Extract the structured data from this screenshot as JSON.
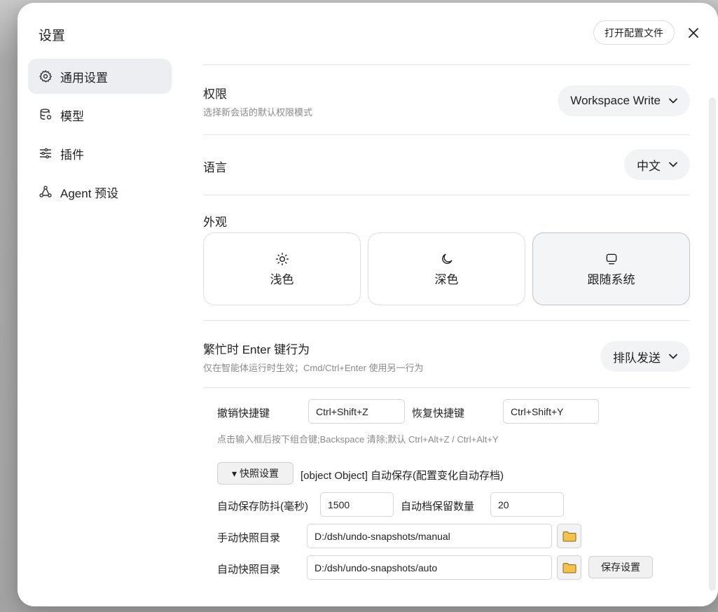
{
  "modal": {
    "title": "设置",
    "open_config_label": "打开配置文件"
  },
  "sidebar": {
    "items": [
      {
        "label": "通用设置",
        "icon": "gear-icon",
        "active": true
      },
      {
        "label": "模型",
        "icon": "database-icon",
        "active": false
      },
      {
        "label": "插件",
        "icon": "sliders-icon",
        "active": false
      },
      {
        "label": "Agent 预设",
        "icon": "network-icon",
        "active": false
      }
    ]
  },
  "permissions": {
    "title": "权限",
    "subtitle": "选择新会话的默认权限模式",
    "value": "Workspace Write"
  },
  "language": {
    "title": "语言",
    "value": "中文"
  },
  "appearance": {
    "title": "外观",
    "options": [
      {
        "label": "浅色",
        "icon": "sun-icon"
      },
      {
        "label": "深色",
        "icon": "moon-icon"
      },
      {
        "label": "跟随系统",
        "icon": "monitor-icon"
      }
    ],
    "selected": "跟随系统"
  },
  "busy_enter": {
    "title": "繁忙时 Enter 键行为",
    "subtitle": "仅在智能体运行时生效；Cmd/Ctrl+Enter 使用另一行为",
    "value": "排队发送"
  },
  "shortcuts": {
    "undo_label": "撤销快捷键",
    "undo_value": "Ctrl+Shift+Z",
    "redo_label": "恢复快捷键",
    "redo_value": "Ctrl+Shift+Y",
    "hint": "点击输入框后按下组合键;Backspace 清除;默认 Ctrl+Alt+Z / Ctrl+Alt+Y"
  },
  "snapshot": {
    "toggle_label": "▾ 快照设置",
    "status_text": "[object Object] 自动保存(配置变化自动存档)",
    "debounce_label": "自动保存防抖(毫秒)",
    "debounce_value": "1500",
    "keep_label": "自动档保留数量",
    "keep_value": "20",
    "manual_dir_label": "手动快照目录",
    "manual_dir_value": "D:/dsh/undo-snapshots/manual",
    "auto_dir_label": "自动快照目录",
    "auto_dir_value": "D:/dsh/undo-snapshots/auto",
    "save_label": "保存设置"
  },
  "colors": {
    "accent_bg": "#eceef1",
    "folder": "#f2c14e"
  }
}
